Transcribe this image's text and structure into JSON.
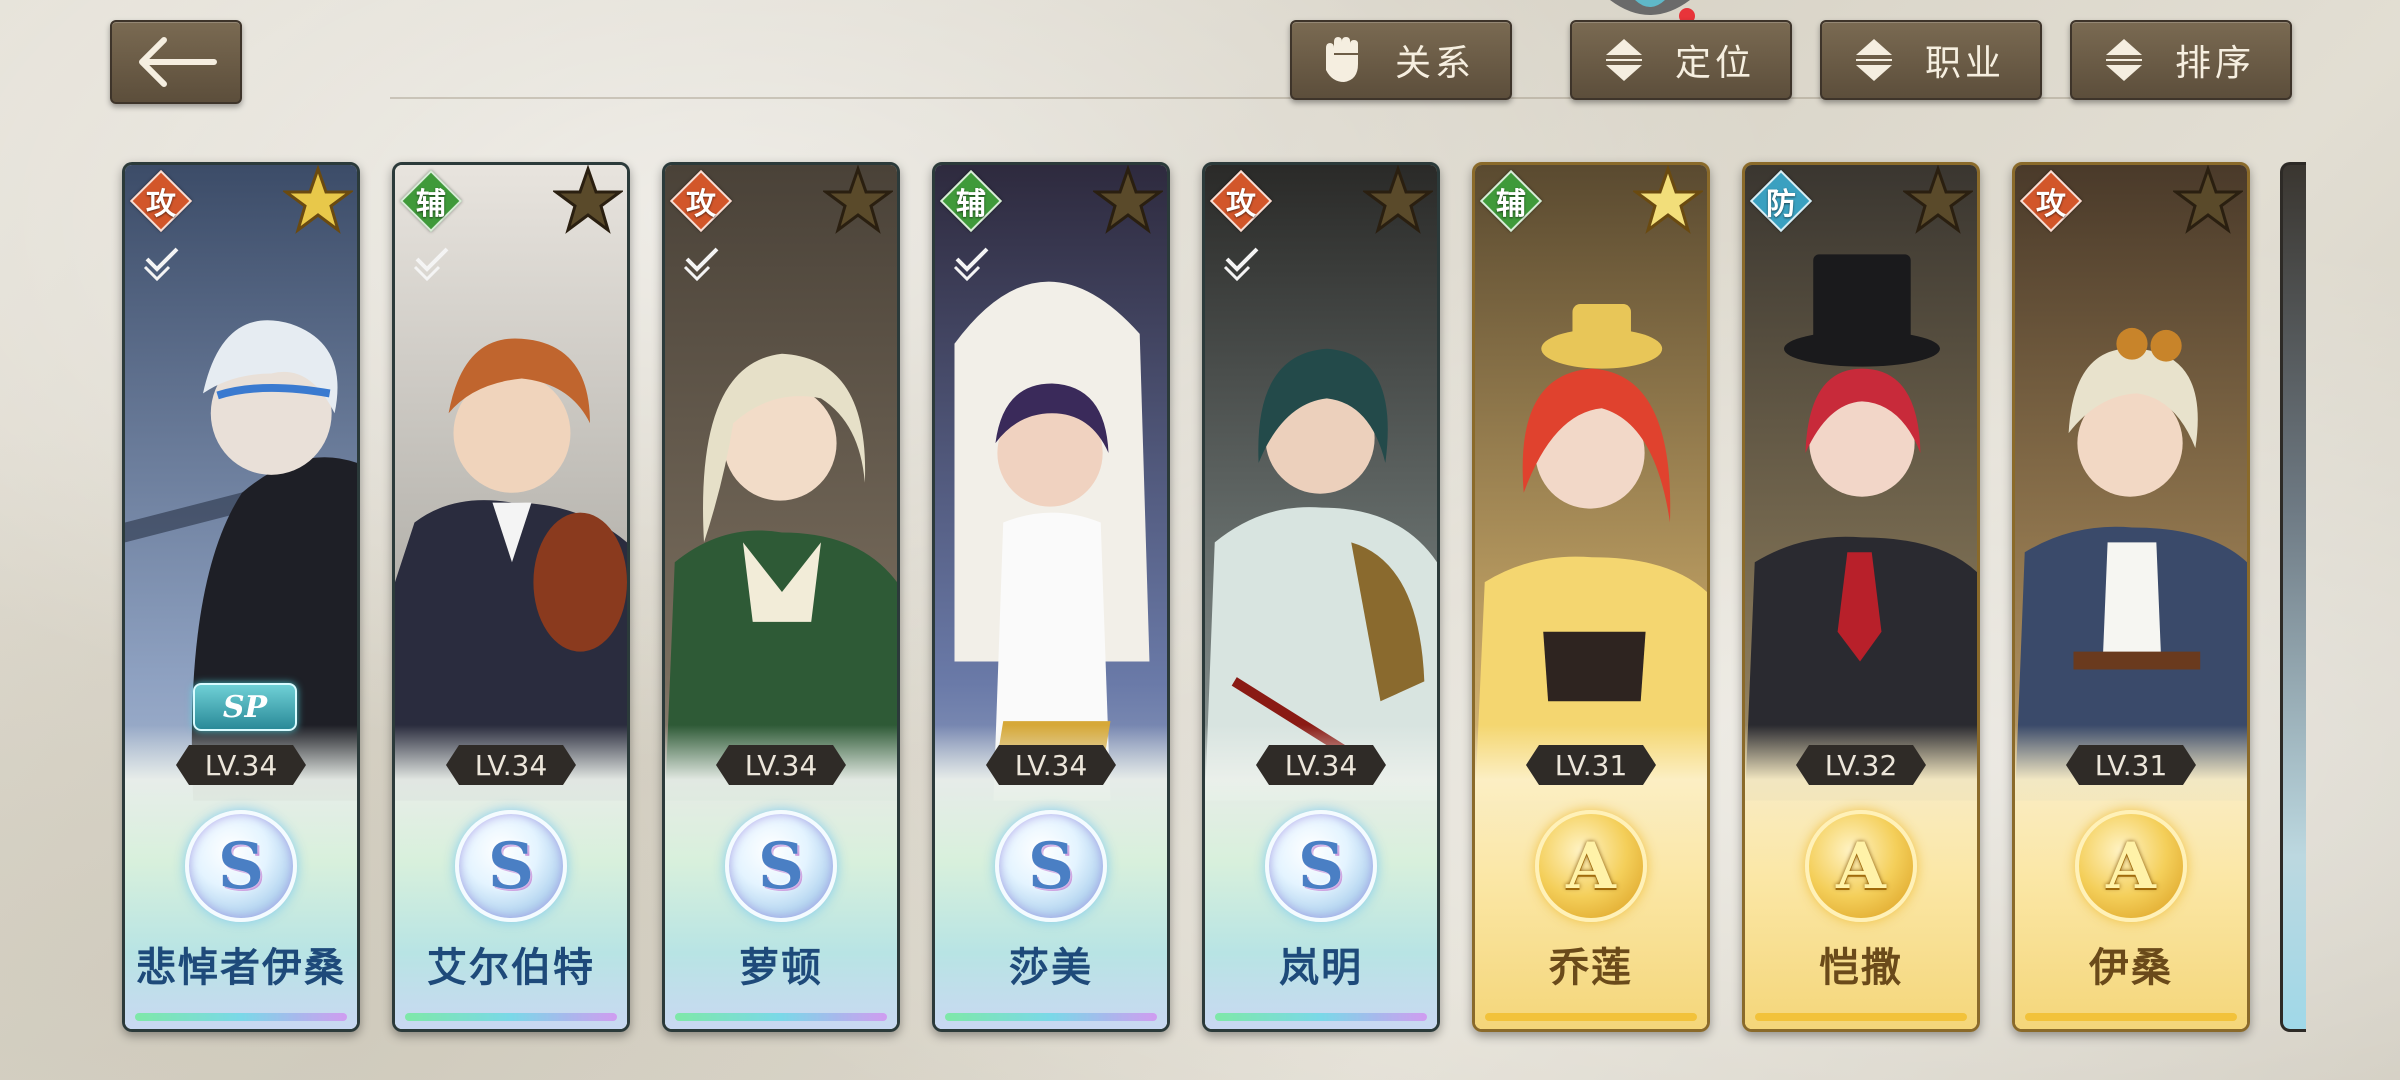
{
  "toolbar": {
    "back_icon": "arrow-left-icon",
    "filters": [
      {
        "label": "关系",
        "icon": "hand-icon"
      },
      {
        "label": "定位",
        "icon": "sort-arrows-icon"
      },
      {
        "label": "职业",
        "icon": "sort-arrows-icon"
      },
      {
        "label": "排序",
        "icon": "sort-arrows-icon"
      }
    ]
  },
  "colors": {
    "attack": "#d2562a",
    "support": "#3f9a3a",
    "defense": "#3aa0c0",
    "rank_s": "#4a7fc4",
    "rank_a": "#e0a524"
  },
  "characters": [
    {
      "name": "悲悼者伊桑",
      "role": "攻",
      "level": "LV.34",
      "rank": "S",
      "badge": "SP"
    },
    {
      "name": "艾尔伯特",
      "role": "辅",
      "level": "LV.34",
      "rank": "S"
    },
    {
      "name": "萝顿",
      "role": "攻",
      "level": "LV.34",
      "rank": "S"
    },
    {
      "name": "莎美",
      "role": "辅",
      "level": "LV.34",
      "rank": "S"
    },
    {
      "name": "岚明",
      "role": "攻",
      "level": "LV.34",
      "rank": "S"
    },
    {
      "name": "乔莲",
      "role": "辅",
      "level": "LV.31",
      "rank": "A"
    },
    {
      "name": "恺撒",
      "role": "防",
      "level": "LV.32",
      "rank": "A"
    },
    {
      "name": "伊桑",
      "role": "攻",
      "level": "LV.31",
      "rank": "A"
    }
  ]
}
